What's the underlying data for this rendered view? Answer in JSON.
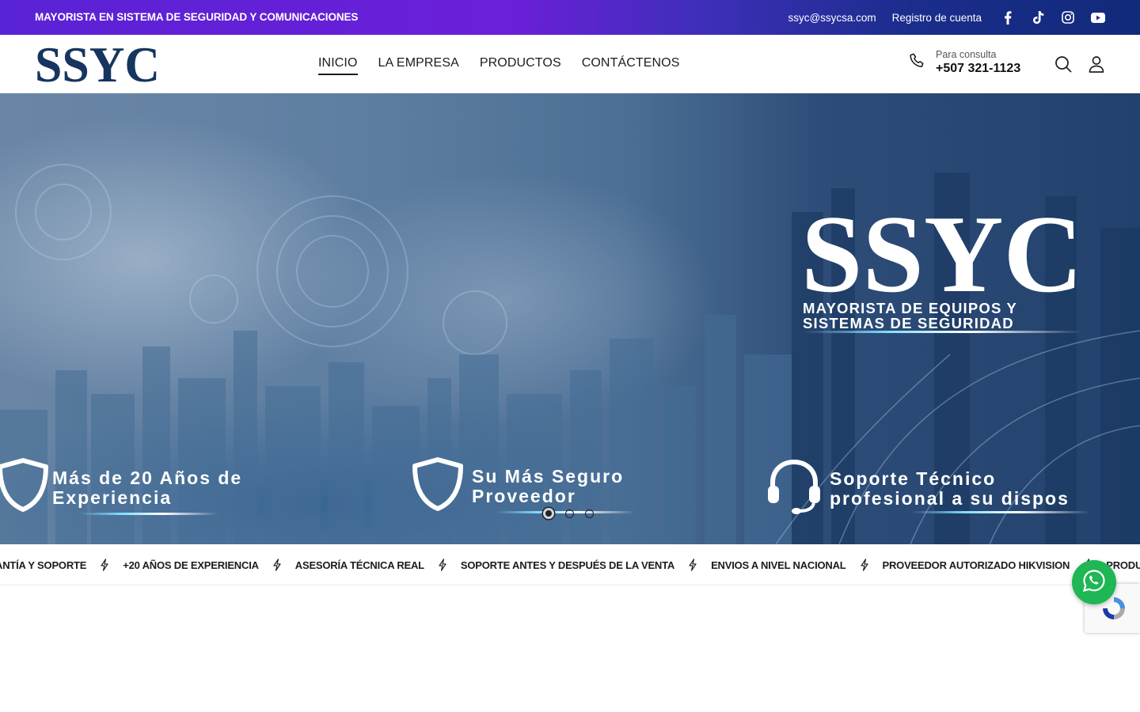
{
  "topbar": {
    "tagline": "MAYORISTA EN SISTEMA DE SEGURIDAD Y COMUNICACIONES",
    "email": "ssyc@ssycsa.com",
    "register": "Registro de cuenta",
    "social": [
      "facebook-icon",
      "tiktok-icon",
      "instagram-icon",
      "youtube-icon"
    ]
  },
  "header": {
    "logo_text": "SSYC",
    "nav": [
      "INICIO",
      "LA EMPRESA",
      "PRODUCTOS",
      "CONTÁCTENOS"
    ],
    "active_nav": "INICIO",
    "contact_label": "Para consulta",
    "contact_phone": "+507 321-1123"
  },
  "hero": {
    "brand": "SSYC",
    "brand_sub_1": "MAYORISTA DE EQUIPOS Y",
    "brand_sub_2": "SISTEMAS DE SEGURIDAD",
    "features": [
      {
        "line1": "Más de 20 Años de",
        "line2": "Experiencia",
        "icon": "shield-icon"
      },
      {
        "line1": "Su Más Seguro",
        "line2": "Proveedor",
        "icon": "shield-icon"
      },
      {
        "line1": "Soporte Técnico",
        "line2": "profesional a su dispos",
        "icon": "headset-icon"
      }
    ],
    "slides": 3,
    "active_slide": 1
  },
  "marquee": [
    "ANTÍA Y SOPORTE",
    "+20 AÑOS DE EXPERIENCIA",
    "ASESORÍA TÉCNICA REAL",
    "SOPORTE ANTES Y DESPUÉS DE LA VENTA",
    "ENVIOS A NIVEL NACIONAL",
    "PROVEEDOR AUTORIZADO HIKVISION",
    "PRODUCTOS CERTIFICADOS"
  ],
  "colors": {
    "brand_navy": "#16355f",
    "whatsapp": "#1fb655"
  }
}
